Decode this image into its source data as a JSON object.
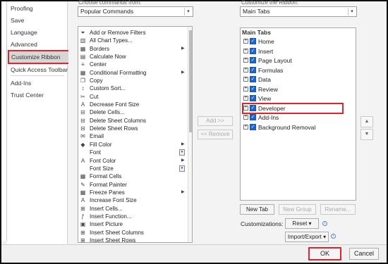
{
  "sidebar": {
    "items": [
      {
        "label": "Proofing"
      },
      {
        "label": "Save"
      },
      {
        "label": "Language"
      },
      {
        "label": "Advanced"
      },
      {
        "label": "Customize Ribbon",
        "selected": true
      },
      {
        "label": "Quick Access Toolbar"
      },
      {
        "label": "Add-Ins"
      },
      {
        "label": "Trust Center"
      }
    ]
  },
  "left_panel": {
    "heading": "Choose commands from:",
    "dropdown_value": "Popular Commands",
    "commands": [
      {
        "label": "Add or Remove Filters",
        "icon": "filter-icon"
      },
      {
        "label": "All Chart Types...",
        "icon": "chart-icon"
      },
      {
        "label": "Borders",
        "icon": "borders-icon",
        "submenu": true
      },
      {
        "label": "Calculate Now",
        "icon": "calculator-icon"
      },
      {
        "label": "Center",
        "icon": "center-align-icon"
      },
      {
        "label": "Conditional Formatting",
        "icon": "conditional-format-icon",
        "submenu": true
      },
      {
        "label": "Copy",
        "icon": "copy-icon"
      },
      {
        "label": "Custom Sort...",
        "icon": "sort-icon"
      },
      {
        "label": "Cut",
        "icon": "scissors-icon"
      },
      {
        "label": "Decrease Font Size",
        "icon": "decrease-font-icon"
      },
      {
        "label": "Delete Cells...",
        "icon": "delete-cells-icon"
      },
      {
        "label": "Delete Sheet Columns",
        "icon": "delete-columns-icon"
      },
      {
        "label": "Delete Sheet Rows",
        "icon": "delete-rows-icon"
      },
      {
        "label": "Email",
        "icon": "email-icon"
      },
      {
        "label": "Fill Color",
        "icon": "fill-color-icon",
        "submenu": true
      },
      {
        "label": "Font",
        "icon": "font-icon",
        "combo": true
      },
      {
        "label": "Font Color",
        "icon": "font-color-icon",
        "submenu": true
      },
      {
        "label": "Font Size",
        "icon": "font-size-icon",
        "combo": true
      },
      {
        "label": "Format Cells",
        "icon": "format-cells-icon"
      },
      {
        "label": "Format Painter",
        "icon": "paintbrush-icon"
      },
      {
        "label": "Freeze Panes",
        "icon": "freeze-panes-icon",
        "submenu": true
      },
      {
        "label": "Increase Font Size",
        "icon": "increase-font-icon"
      },
      {
        "label": "Insert Cells...",
        "icon": "insert-cells-icon"
      },
      {
        "label": "Insert Function...",
        "icon": "function-icon"
      },
      {
        "label": "Insert Picture",
        "icon": "picture-icon"
      },
      {
        "label": "Insert Sheet Columns",
        "icon": "insert-columns-icon"
      },
      {
        "label": "Insert Sheet Rows",
        "icon": "insert-rows-icon"
      }
    ]
  },
  "middle": {
    "add_label": "Add >>",
    "remove_label": "<< Remove"
  },
  "right_panel": {
    "heading": "Customize the Ribbon:",
    "dropdown_value": "Main Tabs",
    "tree_header": "Main Tabs",
    "tabs": [
      {
        "label": "Home",
        "checked": true
      },
      {
        "label": "Insert",
        "checked": true
      },
      {
        "label": "Page Layout",
        "checked": true
      },
      {
        "label": "Formulas",
        "checked": true
      },
      {
        "label": "Data",
        "checked": true
      },
      {
        "label": "Review",
        "checked": true
      },
      {
        "label": "View",
        "checked": true
      },
      {
        "label": "Developer",
        "checked": true,
        "highlighted": true
      },
      {
        "label": "Add-Ins",
        "checked": true
      },
      {
        "label": "Background Removal",
        "checked": true
      }
    ],
    "new_tab_label": "New Tab",
    "new_group_label": "New Group",
    "rename_label": "Rename...",
    "customizations_label": "Customizations:",
    "reset_label": "Reset ▾",
    "import_export_label": "Import/Export ▾",
    "move_up": "▲",
    "move_down": "▼"
  },
  "footer": {
    "ok_label": "OK",
    "cancel_label": "Cancel"
  },
  "colors": {
    "highlight": "#e0242b",
    "checkbox": "#1f64c9",
    "selected_bg": "#d6d6d6"
  }
}
